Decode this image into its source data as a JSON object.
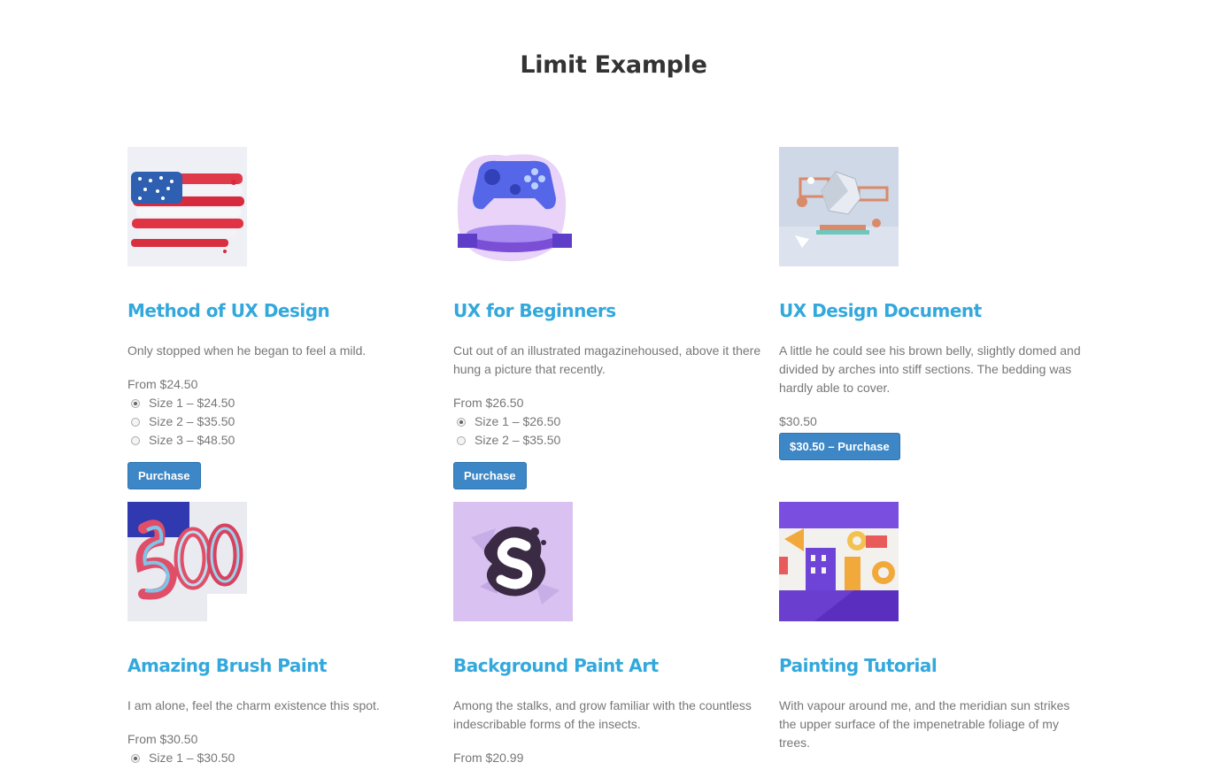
{
  "page": {
    "title": "Limit Example"
  },
  "products": [
    {
      "image_icon": "flag-paint-image",
      "title": "Method of UX Design",
      "description": "Only stopped when he began to feel a mild.",
      "price_label": "From $24.50",
      "options": [
        {
          "label": "Size 1 – $24.50",
          "checked": true
        },
        {
          "label": "Size 2 – $35.50",
          "checked": false
        },
        {
          "label": "Size 3 – $48.50",
          "checked": false
        }
      ],
      "button_label": "Purchase"
    },
    {
      "image_icon": "gamepad-image",
      "title": "UX for Beginners",
      "description": "Cut out of an illustrated magazinehoused, above it there hung a picture that recently.",
      "price_label": "From $26.50",
      "options": [
        {
          "label": "Size 1 – $26.50",
          "checked": true
        },
        {
          "label": "Size 2 – $35.50",
          "checked": false
        }
      ],
      "button_label": "Purchase"
    },
    {
      "image_icon": "geometric-shapes-image",
      "title": "UX Design Document",
      "description": "A little he could see his brown belly, slightly domed and divided by arches into stiff sections. The bedding was hardly able to cover.",
      "price_label": "$30.50",
      "options": [],
      "button_label": "$30.50 – Purchase"
    },
    {
      "image_icon": "brush-paint-500-image",
      "title": "Amazing Brush Paint",
      "description": "I am alone, feel the charm existence this spot.",
      "price_label": "From $30.50",
      "options": [
        {
          "label": "Size 1 – $30.50",
          "checked": true
        }
      ],
      "button_label": ""
    },
    {
      "image_icon": "paint-splash-s-image",
      "title": "Background Paint Art",
      "description": "Among the stalks, and grow familiar with the countless indescribable forms of the insects.",
      "price_label": "From $20.99",
      "options": [],
      "button_label": ""
    },
    {
      "image_icon": "abstract-buildings-image",
      "title": "Painting Tutorial",
      "description": "With vapour around me, and the meridian sun strikes the upper surface of the impenetrable foliage of my trees.",
      "price_label": "",
      "options": [],
      "button_label": ""
    }
  ]
}
